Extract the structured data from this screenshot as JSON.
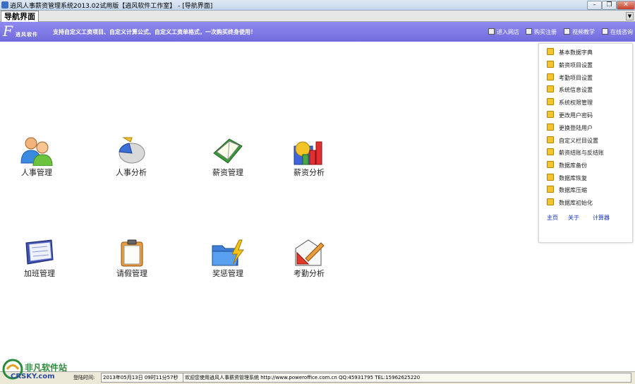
{
  "window": {
    "title": "逍风人事薪资管理系统2013.02试用版【逍风软件工作室】 - [导航界面]",
    "buttons": [
      "–",
      "❐",
      "✕"
    ],
    "inner_buttons": [
      "–",
      "❐",
      "✕"
    ]
  },
  "tab": {
    "label": "导航界面",
    "dropdown": "▼"
  },
  "banner": {
    "logo_mark": "F",
    "company": "逍风软件",
    "slogan": "支持自定义工资项目、自定义计算公式、自定义工资单格式，一次购买终身使用！",
    "links": [
      "进入网店",
      "购买注册",
      "视频教学",
      "在线咨询"
    ]
  },
  "modules": [
    {
      "label": "人事管理",
      "icon": "users-icon"
    },
    {
      "label": "人事分析",
      "icon": "pie-chart-icon"
    },
    {
      "label": "薪资管理",
      "icon": "book-icon"
    },
    {
      "label": "薪资分析",
      "icon": "bar-chart-icon"
    },
    {
      "label": "加班管理",
      "icon": "notebook-icon"
    },
    {
      "label": "请假管理",
      "icon": "clipboard-icon"
    },
    {
      "label": "奖惩管理",
      "icon": "folder-lightning-icon"
    },
    {
      "label": "考勤分析",
      "icon": "ruler-triangle-icon"
    }
  ],
  "menu": {
    "items": [
      "基本数据字典",
      "薪资项目设置",
      "考勤项目设置",
      "系统信息设置",
      "系统权限管理",
      "更改用户密码",
      "更换登陆用户",
      "自定义栏目设置",
      "薪资结账与反结账",
      "数据库备份",
      "数据库恢复",
      "数据库压缩",
      "数据库初始化"
    ],
    "links": [
      "主页",
      "关于",
      "计算器"
    ]
  },
  "status": {
    "login_label": "登陆时间:",
    "login_time": "2013年05月13日  09时11分57秒",
    "message": "欢迎您使用逍风人事薪资管理系统 http://www.poweroffice.com.cn QQ:45931795 TEL:15962625220"
  },
  "watermark": {
    "title": "非凡软件站",
    "site": "CRSKY.com"
  },
  "colors": {
    "banner": "#7a75e2",
    "menu_icon": "#f3c430",
    "link": "#1030c0"
  }
}
